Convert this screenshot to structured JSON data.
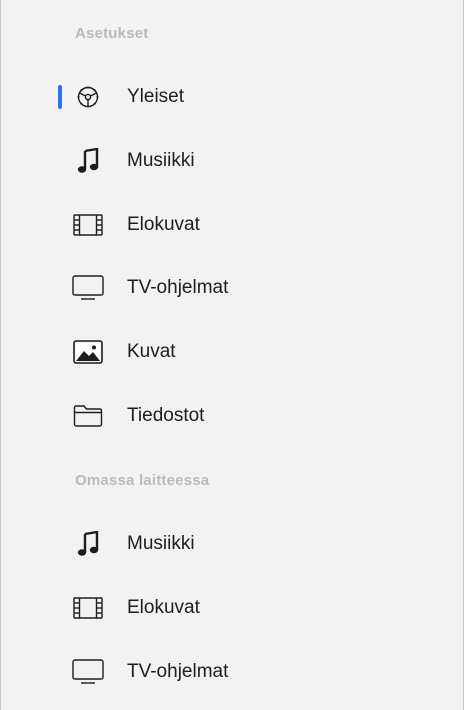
{
  "sections": [
    {
      "title": "Asetukset",
      "items": [
        {
          "label": "Yleiset",
          "icon": "gear-icon",
          "selected": true
        },
        {
          "label": "Musiikki",
          "icon": "music-note-icon"
        },
        {
          "label": "Elokuvat",
          "icon": "film-icon"
        },
        {
          "label": "TV-ohjelmat",
          "icon": "tv-icon"
        },
        {
          "label": "Kuvat",
          "icon": "photo-icon"
        },
        {
          "label": "Tiedostot",
          "icon": "folder-icon"
        }
      ]
    },
    {
      "title": "Omassa laitteessa",
      "items": [
        {
          "label": "Musiikki",
          "icon": "music-note-icon"
        },
        {
          "label": "Elokuvat",
          "icon": "film-icon"
        },
        {
          "label": "TV-ohjelmat",
          "icon": "tv-icon"
        }
      ]
    }
  ],
  "colors": {
    "background": "#f2f2f2",
    "selection_indicator": "#2f6fec",
    "section_header": "#bababa",
    "text": "#1d1d1f"
  }
}
